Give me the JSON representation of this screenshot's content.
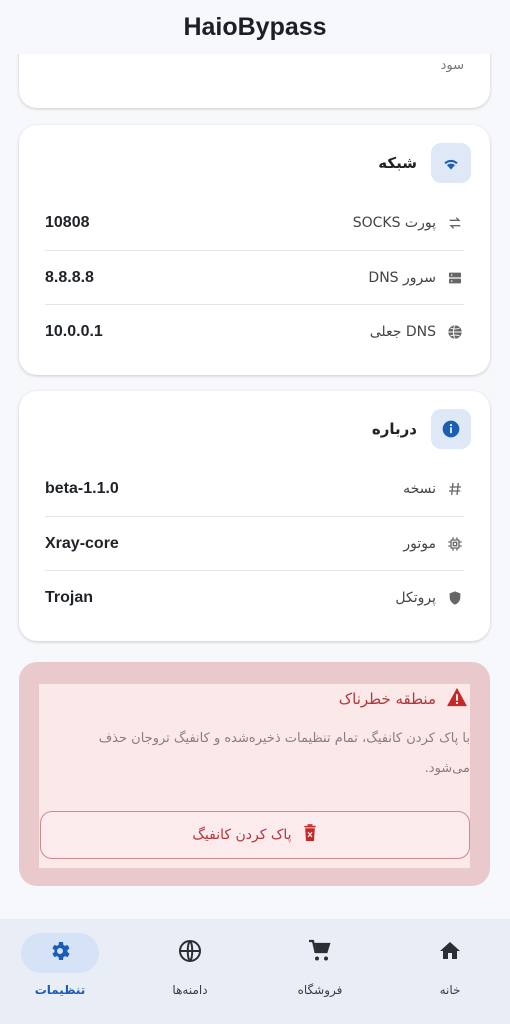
{
  "app": {
    "title": "HaioBypass"
  },
  "top_card": {
    "partial_text": "سود"
  },
  "network": {
    "title": "شبکه",
    "rows": [
      {
        "label": "پورت SOCKS",
        "value": "10808",
        "icon": "swap-arrows-icon"
      },
      {
        "label": "سرور DNS",
        "value": "8.8.8.8",
        "icon": "server-icon"
      },
      {
        "label": "DNS جعلی",
        "value": "10.0.0.1",
        "icon": "globe-icon"
      }
    ]
  },
  "about": {
    "title": "درباره",
    "rows": [
      {
        "label": "نسخه",
        "value": "beta-1.1.0",
        "icon": "hash-icon"
      },
      {
        "label": "موتور",
        "value": "Xray-core",
        "icon": "chip-icon"
      },
      {
        "label": "پروتکل",
        "value": "Trojan",
        "icon": "shield-icon"
      }
    ]
  },
  "danger_zone": {
    "title": "منطقه خطرناک",
    "description": "با پاک کردن کانفیگ، تمام تنظیمات ذخیره‌شده و کانفیگ تروجان حذف می‌شود.",
    "button_label": "پاک کردن کانفیگ"
  },
  "bottom_nav": {
    "items": [
      {
        "label": "خانه",
        "icon": "home-icon"
      },
      {
        "label": "فروشگاه",
        "icon": "cart-icon"
      },
      {
        "label": "دامنه‌ها",
        "icon": "globe-icon"
      },
      {
        "label": "تنظیمات",
        "icon": "gear-icon",
        "active": true
      }
    ]
  },
  "colors": {
    "accent": "#1a5fb4",
    "danger": "#b3363b",
    "danger_bg": "#fbe9ea"
  }
}
